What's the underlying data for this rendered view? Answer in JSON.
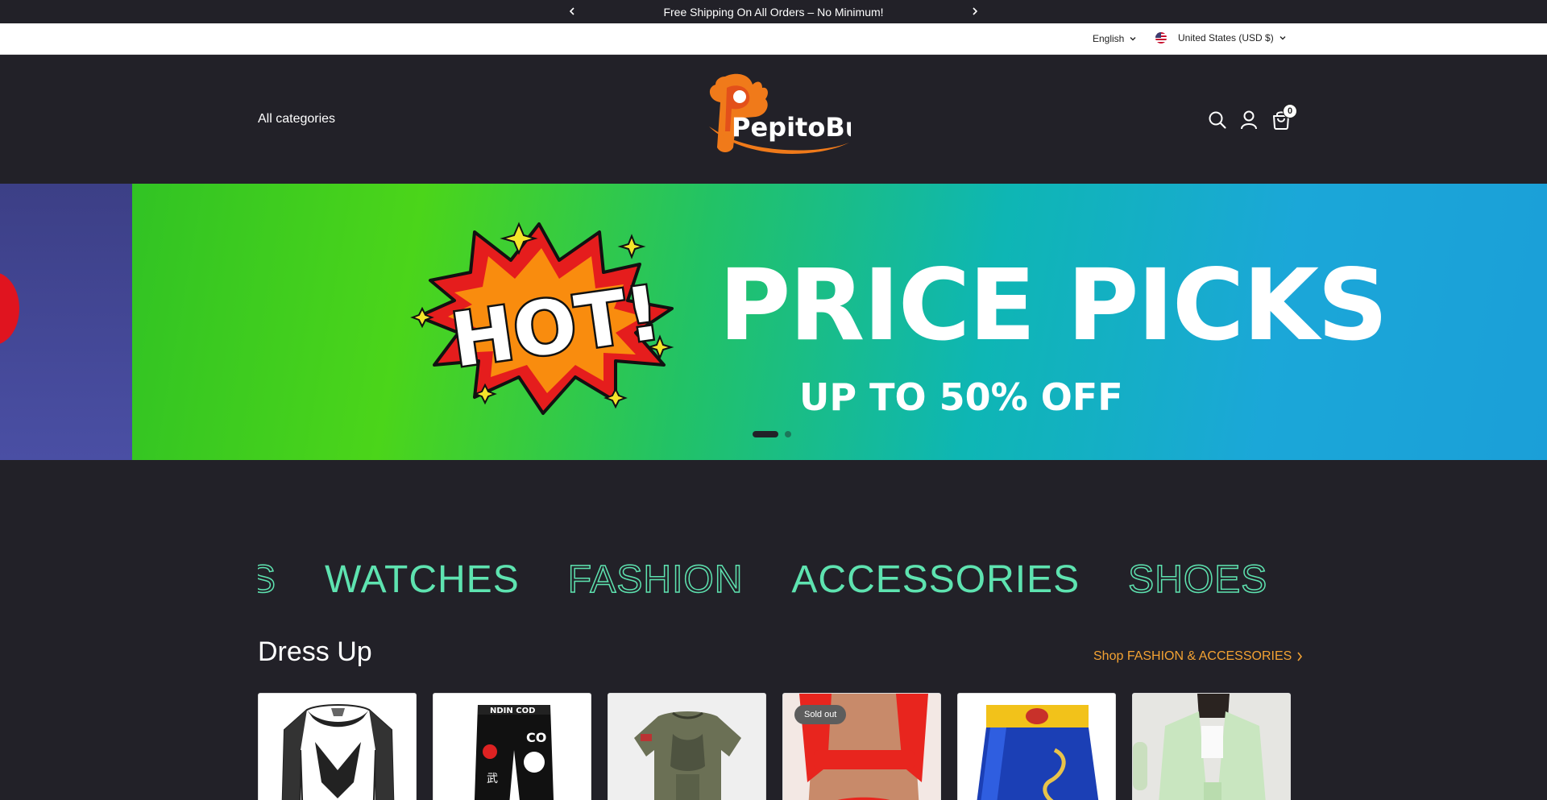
{
  "announcement": {
    "text": " Free Shipping On All Orders – No Minimum!",
    "prev_icon": "chevron-left-icon",
    "next_icon": "chevron-right-icon"
  },
  "locale": {
    "language": "English",
    "currency": "United States (USD $)"
  },
  "header": {
    "all_categories": "All categories",
    "logo_text": "PepitoBuy",
    "cart_count": "0"
  },
  "hero": {
    "hot_text": "HOT!",
    "headline": "PRICE PICKS",
    "subline": "UP TO 50% OFF",
    "slide_count": 2,
    "active_slide": 1
  },
  "marquee": {
    "items": [
      "SHOES",
      "WATCHES",
      "FASHION",
      "ACCESSORIES",
      "SHOES"
    ]
  },
  "section": {
    "title": "Dress Up",
    "link": "Shop FASHION & ACCESSORIES",
    "products": [
      {
        "name": "compression-shirt",
        "badge": ""
      },
      {
        "name": "compression-pants",
        "badge": ""
      },
      {
        "name": "camo-shirt",
        "badge": ""
      },
      {
        "name": "red-crop-top",
        "badge": "Sold out"
      },
      {
        "name": "boxing-shorts",
        "badge": ""
      },
      {
        "name": "green-jacket",
        "badge": ""
      }
    ]
  },
  "colors": {
    "background": "#222128",
    "accent": "#5ee3b0",
    "link": "#f3a233"
  }
}
